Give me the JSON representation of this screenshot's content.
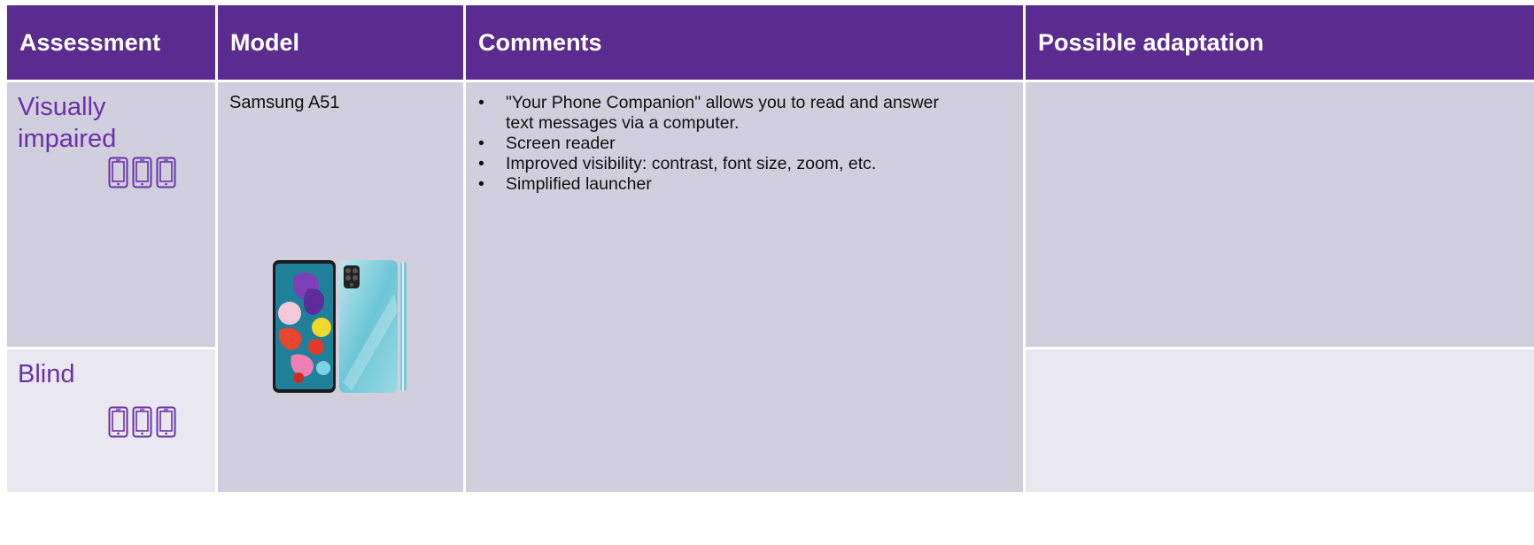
{
  "table": {
    "headers": [
      "Assessment",
      "Model",
      "Comments",
      "Possible adaptation"
    ],
    "rows": [
      {
        "assessment": [
          "Visually",
          "impaired"
        ],
        "adaptation": ""
      },
      {
        "assessment": [
          "Blind"
        ],
        "adaptation": ""
      }
    ],
    "model": "Samsung A51",
    "comments": [
      "\"Your Phone Companion\" allows you to read and answer text messages via a computer.",
      "Screen reader",
      "Improved visibility: contrast, font size, zoom, etc.",
      "Simplified launcher"
    ]
  },
  "icons": {
    "rating_icon": "smartphone-outline-icon",
    "phone_image": "samsung-galaxy-a51-photo"
  },
  "colors": {
    "header_bg": "#5b2c8f",
    "header_text": "#ffffff",
    "label_purple": "#6a32a8",
    "cell_dark": "#d1cedd",
    "cell_light": "#e9e7ef"
  }
}
